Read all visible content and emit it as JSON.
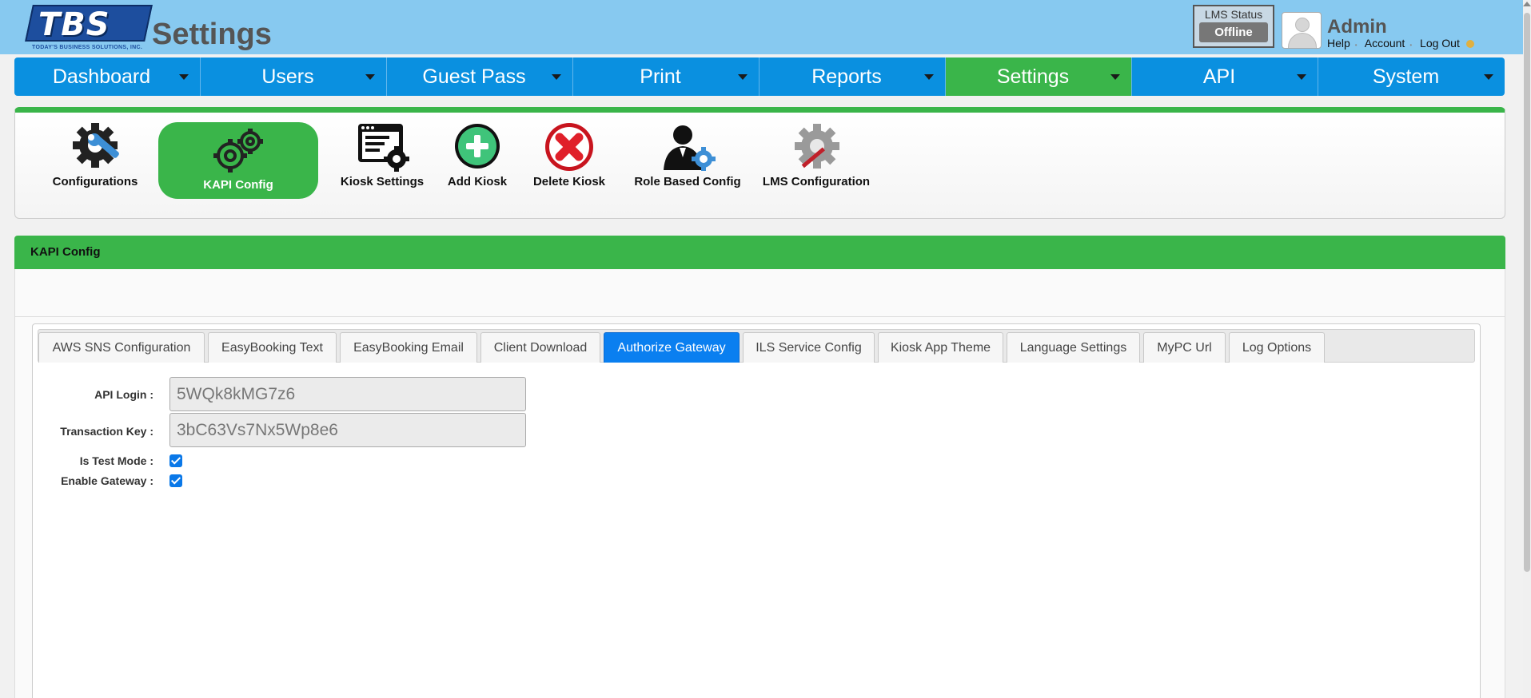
{
  "header": {
    "logo_text": "TBS",
    "logo_subtitle": "TODAY'S BUSINESS SOLUTIONS, INC.",
    "title": "Settings",
    "lms_status": {
      "label": "LMS Status",
      "value": "Offline"
    },
    "user": {
      "name": "Admin",
      "links": {
        "help": "Help",
        "account": "Account",
        "logout": "Log Out"
      }
    }
  },
  "nav": [
    {
      "label": "Dashboard"
    },
    {
      "label": "Users"
    },
    {
      "label": "Guest Pass"
    },
    {
      "label": "Print"
    },
    {
      "label": "Reports"
    },
    {
      "label": "Settings"
    },
    {
      "label": "API"
    },
    {
      "label": "System"
    }
  ],
  "toolbar": [
    {
      "label": "Configurations",
      "icon": "gear-wrench-icon"
    },
    {
      "label": "KAPI Config",
      "icon": "gears-icon"
    },
    {
      "label": "Kiosk Settings",
      "icon": "kiosk-settings-icon"
    },
    {
      "label": "Add Kiosk",
      "icon": "add-icon"
    },
    {
      "label": "Delete Kiosk",
      "icon": "delete-icon"
    },
    {
      "label": "Role Based Config",
      "icon": "user-gear-icon"
    },
    {
      "label": "LMS Configuration",
      "icon": "gear-pen-icon"
    }
  ],
  "section": {
    "title": "KAPI Config"
  },
  "tabs": [
    {
      "label": "AWS SNS Configuration"
    },
    {
      "label": "EasyBooking Text"
    },
    {
      "label": "EasyBooking Email"
    },
    {
      "label": "Client Download"
    },
    {
      "label": "Authorize Gateway"
    },
    {
      "label": "ILS Service Config"
    },
    {
      "label": "Kiosk App Theme"
    },
    {
      "label": "Language Settings"
    },
    {
      "label": "MyPC Url"
    },
    {
      "label": "Log Options"
    }
  ],
  "form": {
    "api_login": {
      "label": "API Login :",
      "value": "5WQk8kMG7z6"
    },
    "transaction_key": {
      "label": "Transaction Key :",
      "value": "3bC63Vs7Nx5Wp8e6"
    },
    "is_test_mode": {
      "label": "Is Test Mode :",
      "checked": true
    },
    "enable_gateway": {
      "label": "Enable Gateway :",
      "checked": true
    }
  },
  "colors": {
    "header_bg": "#87c9f0",
    "nav_blue": "#0a90e0",
    "accent_green": "#3ab54a",
    "active_tab": "#0a7ff0",
    "danger_red": "#d0202a"
  }
}
